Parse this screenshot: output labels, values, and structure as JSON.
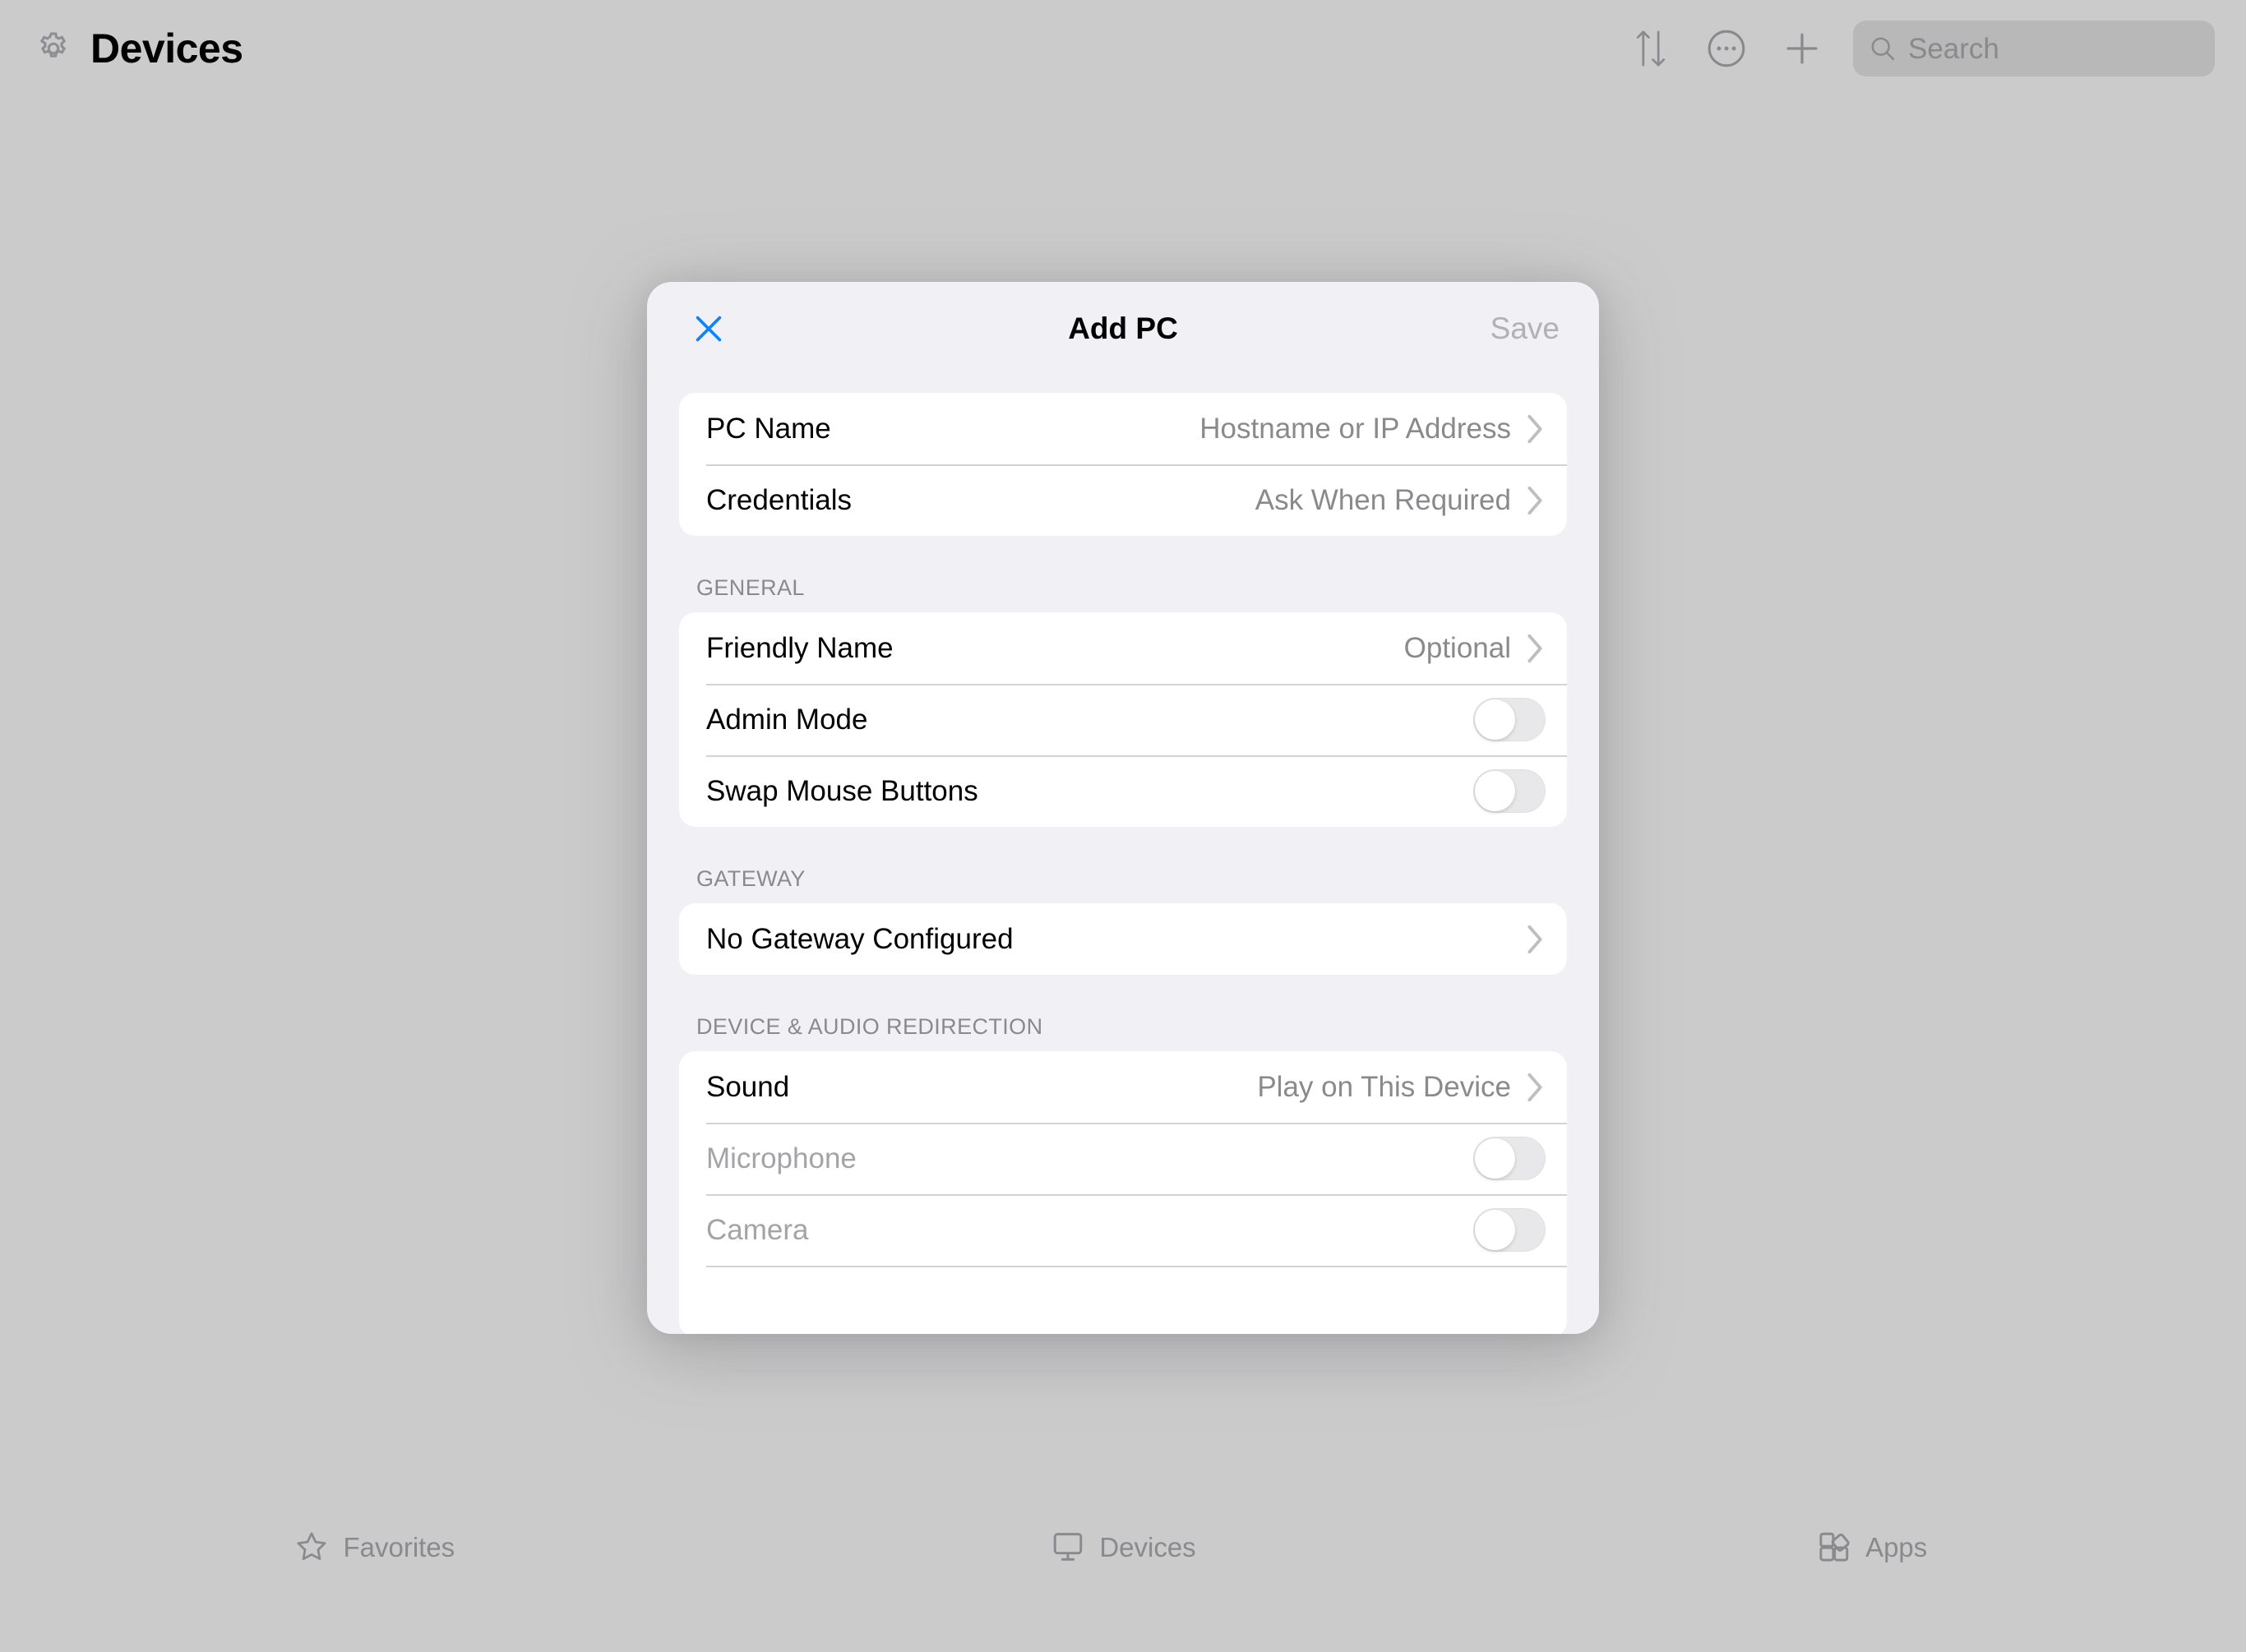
{
  "header": {
    "gear_icon": "gear-icon",
    "title": "Devices",
    "actions": [
      {
        "name": "sort-icon",
        "label": "Sort"
      },
      {
        "name": "more-icon",
        "label": "More"
      },
      {
        "name": "add-icon",
        "label": "Add"
      }
    ],
    "search": {
      "icon": "search-icon",
      "placeholder": "Search",
      "value": ""
    }
  },
  "modal": {
    "close_icon": "close-icon",
    "title": "Add PC",
    "save_label": "Save",
    "sections": [
      {
        "header": "",
        "rows": [
          {
            "label": "PC Name",
            "value": "Hostname or IP Address",
            "control": "chevron",
            "disabled": false
          },
          {
            "label": "Credentials",
            "value": "Ask When Required",
            "control": "chevron",
            "disabled": false
          }
        ]
      },
      {
        "header": "GENERAL",
        "rows": [
          {
            "label": "Friendly Name",
            "value": "Optional",
            "control": "chevron",
            "disabled": false
          },
          {
            "label": "Admin Mode",
            "value": "",
            "control": "toggle",
            "toggle_on": false,
            "disabled": false
          },
          {
            "label": "Swap Mouse Buttons",
            "value": "",
            "control": "toggle",
            "toggle_on": false,
            "disabled": false
          }
        ]
      },
      {
        "header": "GATEWAY",
        "rows": [
          {
            "label": "No Gateway Configured",
            "value": "",
            "control": "chevron",
            "disabled": false
          }
        ]
      },
      {
        "header": "DEVICE & AUDIO REDIRECTION",
        "rows": [
          {
            "label": "Sound",
            "value": "Play on This Device",
            "control": "chevron",
            "disabled": false
          },
          {
            "label": "Microphone",
            "value": "",
            "control": "toggle",
            "toggle_on": false,
            "disabled": true
          },
          {
            "label": "Camera",
            "value": "",
            "control": "toggle",
            "toggle_on": false,
            "disabled": true
          }
        ]
      }
    ]
  },
  "tabbar": {
    "tabs": [
      {
        "icon": "star-icon",
        "label": "Favorites",
        "selected": false
      },
      {
        "icon": "monitor-icon",
        "label": "Devices",
        "selected": false
      },
      {
        "icon": "apps-grid-icon",
        "label": "Apps",
        "selected": false
      }
    ]
  },
  "colors": {
    "accent": "#0a84ff",
    "backdrop": "#cbcbcb",
    "modal_bg": "#f1f1f5",
    "card_bg": "#ffffff",
    "secondary_text": "#8a8a8e",
    "toggle_off_track": "#e8e8ea"
  }
}
